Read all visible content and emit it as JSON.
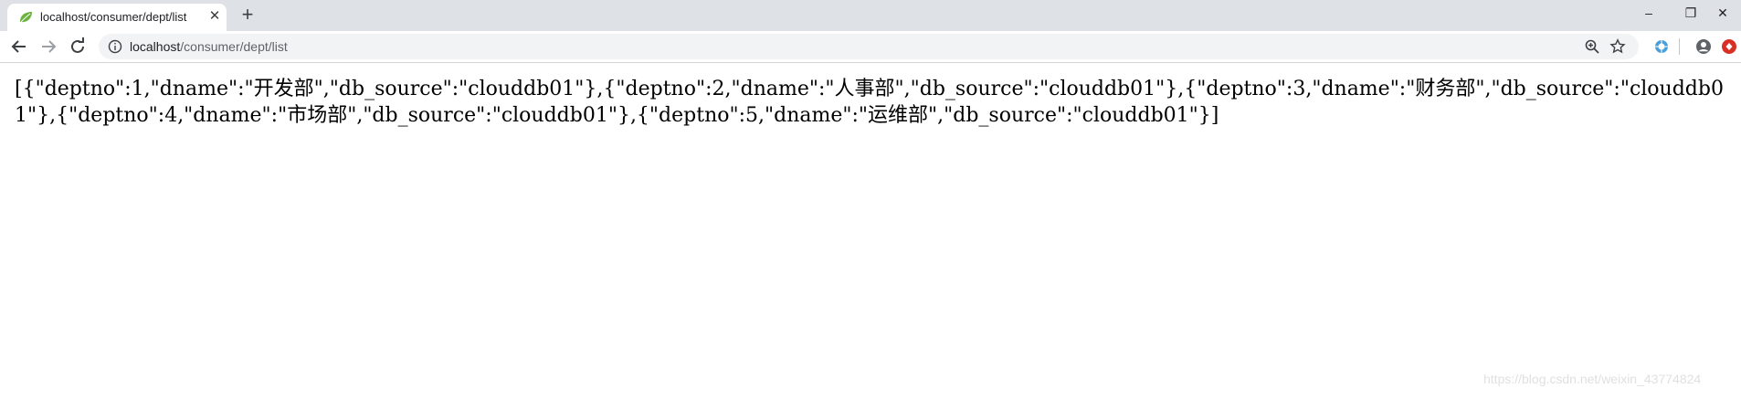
{
  "tab": {
    "title": "localhost/consumer/dept/list",
    "close_icon": "close-icon",
    "favicon_icon": "spring-leaf-icon"
  },
  "new_tab_label": "+",
  "window_controls": {
    "minimize": "–",
    "restore": "❐",
    "close": "✕"
  },
  "toolbar": {
    "url_host": "localhost",
    "url_path": "/consumer/dept/list",
    "icons": [
      "back-icon",
      "forward-icon",
      "reload-icon",
      "info-icon",
      "zoom-icon",
      "star-icon",
      "extension-icon",
      "profile-icon",
      "extension-red-icon"
    ]
  },
  "content": {
    "json_text": "[{\"deptno\":1,\"dname\":\"开发部\",\"db_source\":\"clouddb01\"},{\"deptno\":2,\"dname\":\"人事部\",\"db_source\":\"clouddb01\"},{\"deptno\":3,\"dname\":\"财务部\",\"db_source\":\"clouddb01\"},{\"deptno\":4,\"dname\":\"市场部\",\"db_source\":\"clouddb01\"},{\"deptno\":5,\"dname\":\"运维部\",\"db_source\":\"clouddb01\"}]"
  },
  "watermark": "https://blog.csdn.net/weixin_43774824",
  "colors": {
    "tabstrip_bg": "#dee1e6",
    "omnibox_bg": "#f1f3f4",
    "favicon": "#6db33f",
    "ext_red": "#d93025",
    "ext_blue": "#4a9fd8"
  }
}
